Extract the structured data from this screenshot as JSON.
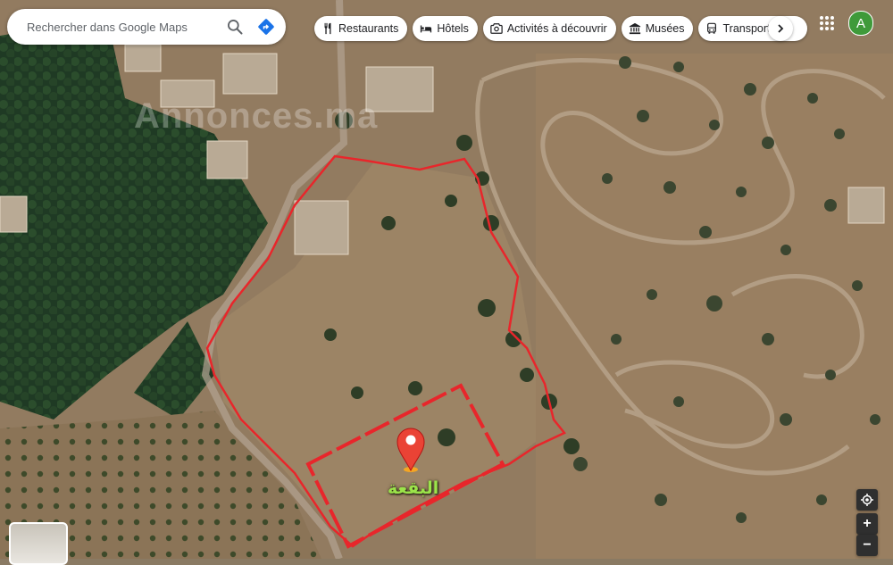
{
  "search": {
    "placeholder": "Rechercher dans Google Maps",
    "search_icon": "search-icon",
    "directions_icon": "directions-icon"
  },
  "categories": [
    {
      "label": "Restaurants",
      "icon": "fork-knife-icon"
    },
    {
      "label": "Hôtels",
      "icon": "bed-icon"
    },
    {
      "label": "Activités à découvrir",
      "icon": "camera-icon"
    },
    {
      "label": "Musées",
      "icon": "museum-icon"
    },
    {
      "label": "Transports en",
      "icon": "bus-icon"
    }
  ],
  "account": {
    "avatar_letter": "A",
    "avatar_color": "#3f9a3a"
  },
  "map": {
    "watermark": "Annonces.ma",
    "pin_label": "البقعة",
    "pin_color": "#ea4335",
    "plot_outline_color": "#e8262b",
    "label_color": "#9be34a"
  },
  "controls": {
    "zoom_in": "+",
    "zoom_out": "−"
  }
}
